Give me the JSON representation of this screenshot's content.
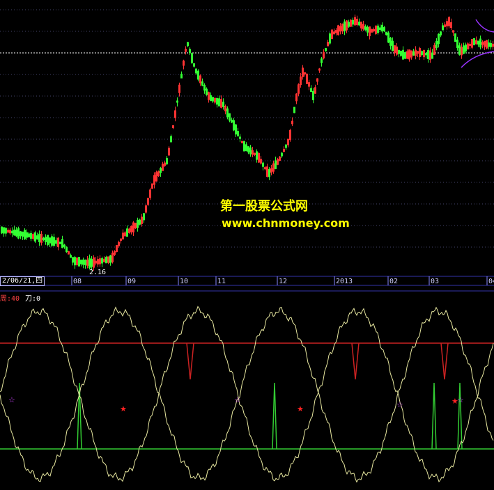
{
  "watermark": {
    "line1": "第一股票公式网",
    "line2": "www.chnmoney.com"
  },
  "price_panel": {
    "low_label": "2.16",
    "ref_line_color": "#ffffff",
    "up_color": "#ff3333",
    "down_color": "#33ff33",
    "ma_color": "#9933ff"
  },
  "axis": {
    "date_box": "2/06/21,四",
    "ticks": [
      "08",
      "09",
      "10",
      "11",
      "12",
      "2013",
      "02",
      "03",
      "04"
    ]
  },
  "indicator": {
    "label_name": "周:40",
    "label_value": "刀:0",
    "label_name_color": "#ff4444",
    "label_value_color": "#ffffff",
    "upper_line_color": "#cc2222",
    "lower_line_color": "#33cc33",
    "curve_color": "#e8e8a0",
    "star_purple": "☆",
    "star_red": "★"
  },
  "chart_data": {
    "type": "candlestick+indicator",
    "title": "",
    "price_low_marker": 2.16,
    "x_ticks": [
      "08",
      "09",
      "10",
      "11",
      "12",
      "2013",
      "02",
      "03",
      "04"
    ],
    "indicator_levels": [
      "upper",
      "lower"
    ]
  }
}
